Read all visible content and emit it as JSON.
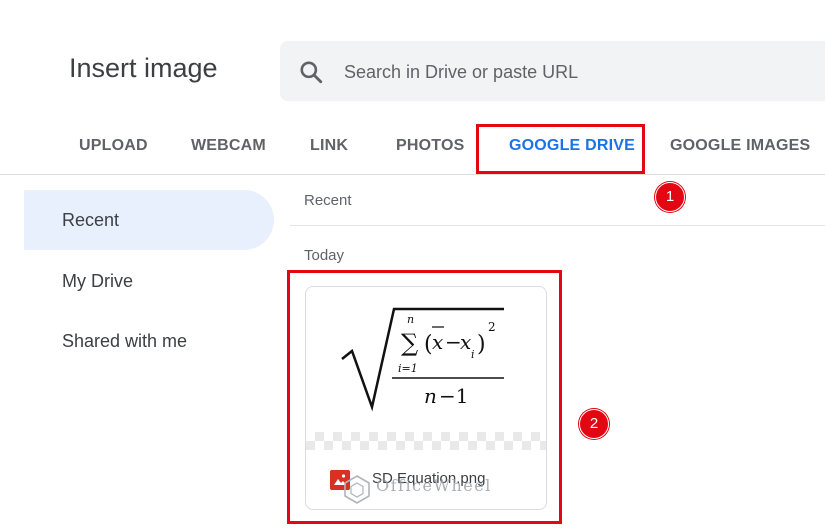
{
  "dialog": {
    "title": "Insert image"
  },
  "search": {
    "placeholder": "Search in Drive or paste URL",
    "icon": "search-icon"
  },
  "tabs": [
    {
      "label": "UPLOAD",
      "active": false
    },
    {
      "label": "WEBCAM",
      "active": false
    },
    {
      "label": "LINK",
      "active": false
    },
    {
      "label": "PHOTOS",
      "active": false
    },
    {
      "label": "GOOGLE DRIVE",
      "active": true
    },
    {
      "label": "GOOGLE IMAGES",
      "active": false
    }
  ],
  "sidebar": {
    "items": [
      {
        "label": "Recent",
        "active": true
      },
      {
        "label": "My Drive",
        "active": false
      },
      {
        "label": "Shared with me",
        "active": false
      }
    ]
  },
  "main": {
    "header": "Recent",
    "group_label": "Today",
    "file": {
      "name": "SD Equation.png",
      "icon": "image-file-icon"
    }
  },
  "annotations": {
    "badge_1": "1",
    "badge_2": "2"
  },
  "watermark": {
    "text": "OfficeWheel"
  },
  "colors": {
    "accent": "#1a73e8",
    "highlight": "#e30613",
    "nav_active_bg": "#e8f0fe"
  }
}
